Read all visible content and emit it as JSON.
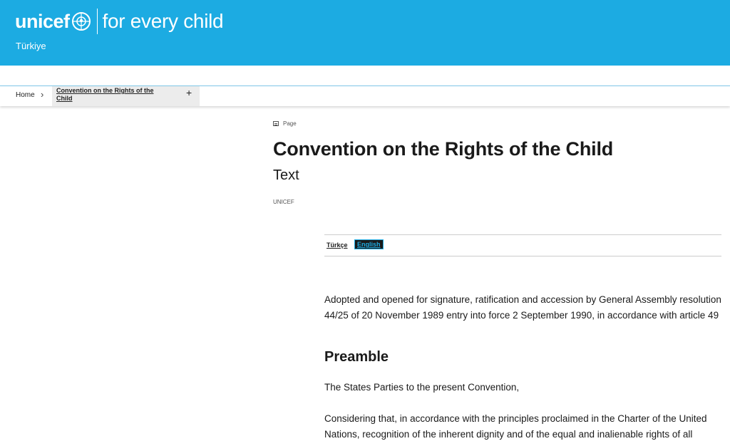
{
  "header": {
    "logo_text": "unicef",
    "tagline": "for every child",
    "country": "Türkiye",
    "brand_color": "#1cabe2"
  },
  "breadcrumb": {
    "home": "Home",
    "current": "Convention on the Rights of the Child",
    "expand_symbol": "+"
  },
  "article": {
    "type_label": "Page",
    "title": "Convention on the Rights of the Child",
    "subtitle": "Text",
    "author": "UNICEF"
  },
  "languages": {
    "turkish": "Türkçe",
    "english": "English",
    "active": "English"
  },
  "content": {
    "intro": "Adopted and opened for signature, ratification and accession by General Assembly resolution 44/25 of 20 November 1989 entry into force 2 September 1990, in accordance with article 49",
    "preamble_heading": "Preamble",
    "paragraph_1": "The States Parties to the present Convention,",
    "paragraph_2": "Considering that, in accordance with the principles proclaimed in the Charter of the United Nations, recognition of the inherent dignity and of the equal and inalienable rights of all"
  }
}
